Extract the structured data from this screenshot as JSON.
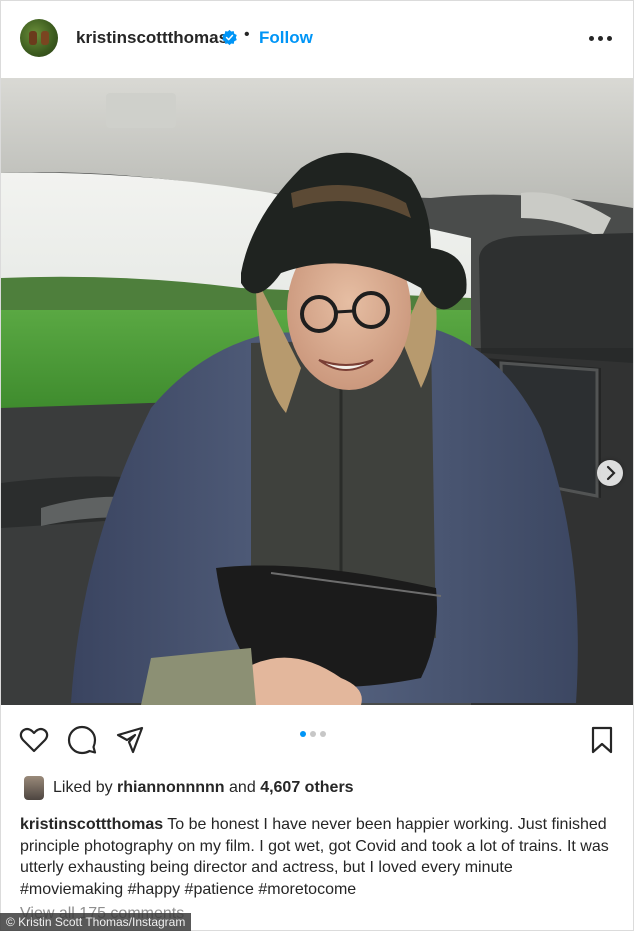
{
  "post": {
    "username": "kristinscottthomas",
    "separator": "•",
    "follow_label": "Follow",
    "verified_icon": "verified-badge-icon",
    "more_icon": "more-options-icon"
  },
  "media": {
    "carousel_count": 3,
    "carousel_active_index": 0,
    "next_icon": "chevron-right-icon",
    "colors": {
      "sky": "#e9ece8",
      "field": "#4f9a3a",
      "jacket": "#44506a",
      "fleece": "#3f413d"
    }
  },
  "actions": {
    "like_icon": "heart-icon",
    "comment_icon": "comment-icon",
    "share_icon": "share-icon",
    "save_icon": "bookmark-icon"
  },
  "likes": {
    "prefix": "Liked by",
    "liker": "rhiannonnnnn",
    "connector": "and",
    "others": "4,607 others"
  },
  "caption": {
    "username": "kristinscottthomas",
    "text": "To be honest I have never been happier working. Just finished principle photography on my film. I got wet, got Covid and took a lot of trains. It was utterly exhausting being director and actress, but I loved every minute #moviemaking #happy #patience #moretocome"
  },
  "comments_link": "View all 175 comments",
  "credit": "© Kristin Scott Thomas/Instagram",
  "accent_color": "#0095f6"
}
